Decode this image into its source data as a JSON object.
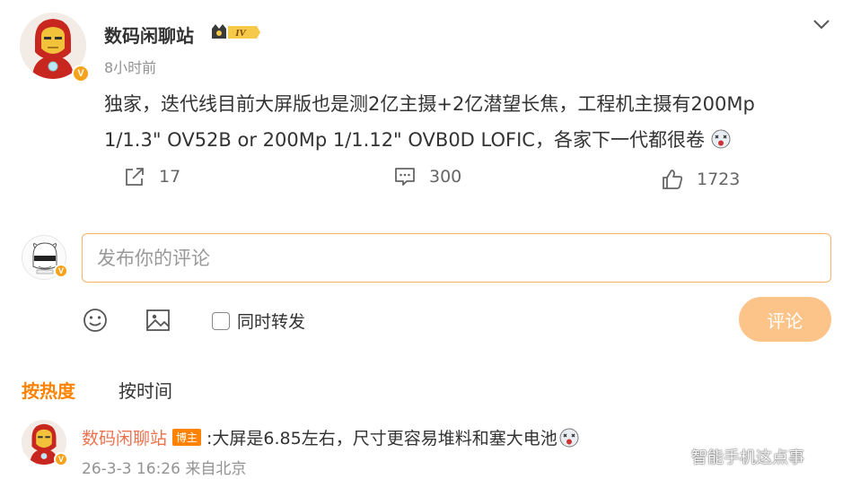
{
  "post": {
    "author": "数码闲聊站",
    "level": "IV",
    "time": "8小时前",
    "content": "独家，迭代线目前大屏版也是测2亿主摄+2亿潜望长焦，工程机主摄有200Mp 1/1.3\" OV52B or 200Mp 1/1.12\" OVB0D LOFIC，各家下一代都很卷",
    "icons": {
      "more": "chevron-down-icon",
      "verified": "verified-v-icon"
    }
  },
  "actions": {
    "repost": {
      "icon": "share-icon",
      "count": "17"
    },
    "comment": {
      "icon": "comment-icon",
      "count": "300"
    },
    "like": {
      "icon": "thumbs-up-icon",
      "count": "1723"
    }
  },
  "composer": {
    "placeholder": "发布你的评论",
    "repost_label": "同时转发",
    "submit_label": "评论",
    "tools": [
      "emoji-icon",
      "image-icon"
    ]
  },
  "sort": {
    "tabs": [
      {
        "label": "按热度",
        "active": true
      },
      {
        "label": "按时间",
        "active": false
      }
    ]
  },
  "comments": [
    {
      "author": "数码闲聊站",
      "tag": "博主",
      "text": ":大屏是6.85左右，尺寸更容易堆料和塞大电池",
      "meta": "26-3-3 16:26 来自北京"
    }
  ],
  "watermark": "智能手机这点事",
  "colors": {
    "accent": "#ff8200",
    "author_link": "#eb7350",
    "input_border": "#f7b366",
    "submit_disabled": "#fdc48a",
    "verified": "#f7a21b",
    "muted": "#939393"
  }
}
